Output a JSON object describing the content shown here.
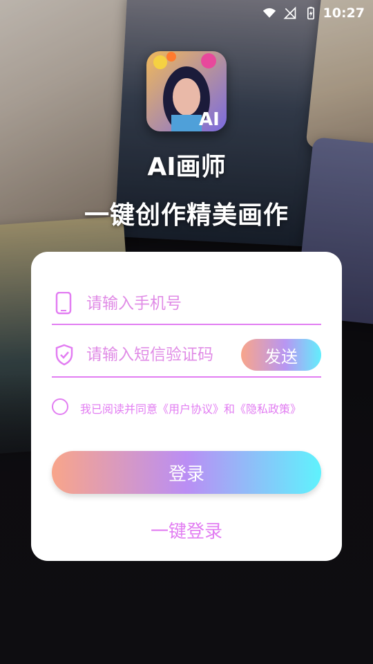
{
  "status_bar": {
    "time": "10:27"
  },
  "app": {
    "name": "AI画师",
    "slogan": "一键创作精美画作",
    "logo_badge": "AI"
  },
  "login_form": {
    "phone_placeholder": "请输入手机号",
    "code_placeholder": "请输入短信验证码",
    "send_label": "发送",
    "agreement_text": "我已阅读并同意《用户协议》和《隐私政策》",
    "login_label": "登录",
    "one_key_login_label": "一键登录"
  },
  "colors": {
    "accent": "#e27df2",
    "gradient_start": "#f8a58a",
    "gradient_mid": "#b896f2",
    "gradient_end": "#62eefc"
  }
}
